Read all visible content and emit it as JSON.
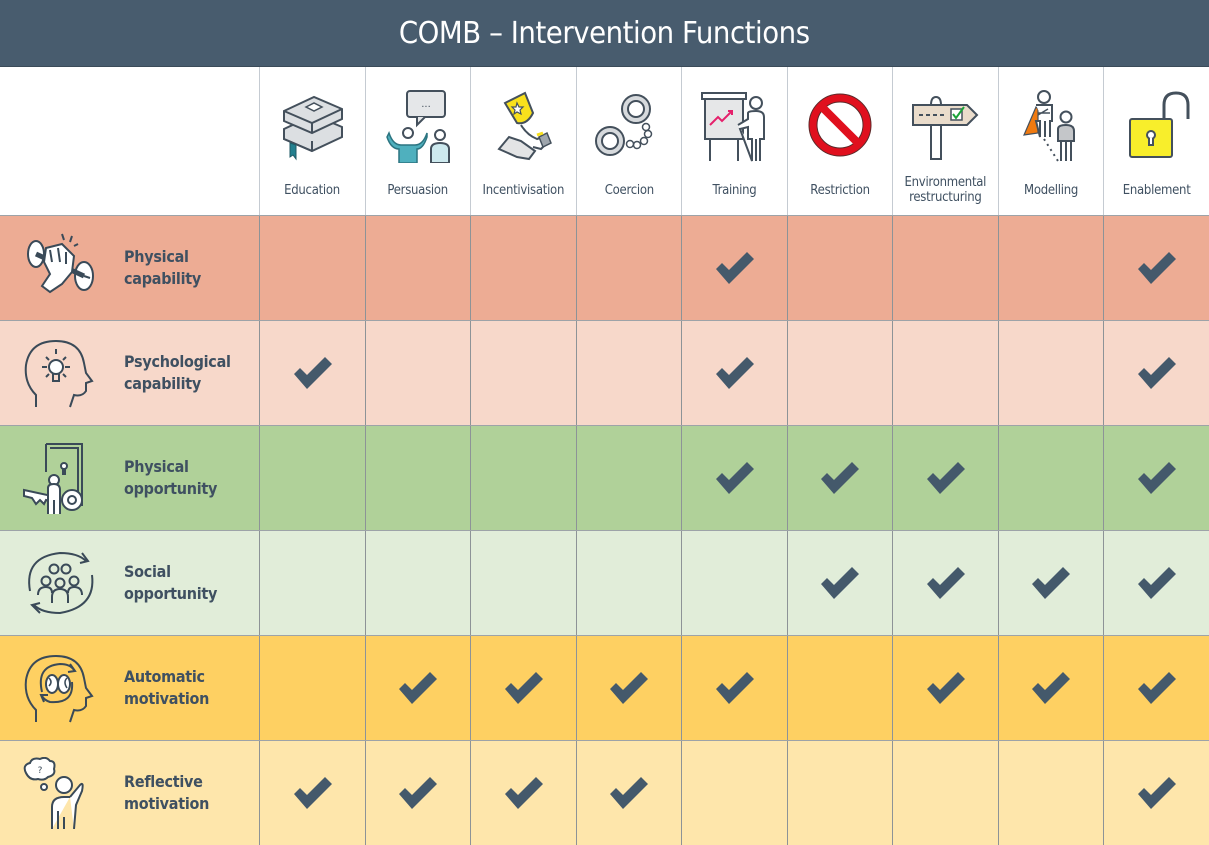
{
  "title": "COMB – Intervention Functions",
  "columns": [
    {
      "key": "education",
      "label": "Education",
      "icon": "books-icon"
    },
    {
      "key": "persuasion",
      "label": "Persuasion",
      "icon": "speaking-person-icon"
    },
    {
      "key": "incentivisation",
      "label": "Incentivisation",
      "icon": "trophy-hand-icon"
    },
    {
      "key": "coercion",
      "label": "Coercion",
      "icon": "handcuffs-icon"
    },
    {
      "key": "training",
      "label": "Training",
      "icon": "presentation-board-icon"
    },
    {
      "key": "restriction",
      "label": "Restriction",
      "icon": "prohibited-sign-icon"
    },
    {
      "key": "environmental_restructuring",
      "label": "Environmental\nrestructuring",
      "icon": "signpost-icon"
    },
    {
      "key": "modelling",
      "label": "Modelling",
      "icon": "hero-role-model-icon"
    },
    {
      "key": "enablement",
      "label": "Enablement",
      "icon": "open-padlock-icon"
    }
  ],
  "rows": [
    {
      "label": "Physical\ncapability",
      "icon": "fist-dumbbell-icon",
      "color": "#edac94",
      "checks": [
        false,
        false,
        false,
        false,
        true,
        false,
        false,
        false,
        true
      ]
    },
    {
      "label": "Psychological\ncapability",
      "icon": "head-lightbulb-icon",
      "color": "#f7d8ca",
      "checks": [
        true,
        false,
        false,
        false,
        true,
        false,
        false,
        false,
        true
      ]
    },
    {
      "label": "Physical\nopportunity",
      "icon": "door-key-icon",
      "color": "#b0d199",
      "checks": [
        false,
        false,
        false,
        false,
        true,
        true,
        true,
        false,
        true
      ]
    },
    {
      "label": "Social\nopportunity",
      "icon": "group-cycle-icon",
      "color": "#e1edd9",
      "checks": [
        false,
        false,
        false,
        false,
        false,
        true,
        true,
        true,
        true
      ]
    },
    {
      "label": "Automatic\nmotivation",
      "icon": "head-brain-cycle-icon",
      "color": "#fed062",
      "checks": [
        false,
        true,
        true,
        true,
        true,
        false,
        true,
        true,
        true
      ]
    },
    {
      "label": "Reflective\nmotivation",
      "icon": "thinking-person-icon",
      "color": "#fee6ab",
      "checks": [
        true,
        true,
        true,
        true,
        false,
        false,
        false,
        false,
        true
      ]
    }
  ],
  "colors": {
    "title_bar": "#485c6e",
    "check_mark": "#44596b",
    "text": "#3f5061"
  }
}
